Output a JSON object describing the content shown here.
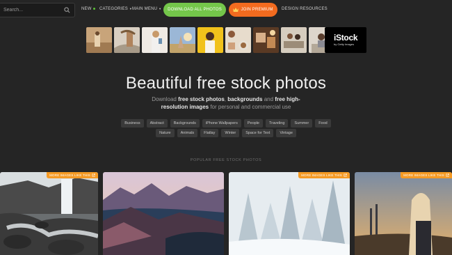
{
  "nav": {
    "search_placeholder": "Search...",
    "new_label": "NEW",
    "categories_label": "CATEGORIES",
    "main_menu_label": "MAIN MENU",
    "download_all_label": "DOWNLOAD ALL PHOTOS",
    "premium_label": "JOIN PREMIUM",
    "design_resources_label": "DESIGN RESOURCES"
  },
  "colors": {
    "accent_green": "#74c64a",
    "accent_orange": "#f26b1f",
    "badge_orange": "#f59a24",
    "background": "#252525"
  },
  "istock": {
    "logo": "iStock",
    "sub": "by Getty Images"
  },
  "hero": {
    "title": "Beautiful free stock photos",
    "sub_prefix": "Download ",
    "sub_b1": "free stock photos",
    "sub_mid1": ", ",
    "sub_b2": "backgrounds",
    "sub_mid2": " and ",
    "sub_b3": "free high-resolution images",
    "sub_suffix": " for personal and commercial use"
  },
  "tags_row1": [
    "Business",
    "Abstract",
    "Backgrounds",
    "iPhone Wallpapers",
    "People",
    "Traveling",
    "Summer",
    "Food"
  ],
  "tags_row2": [
    "Nature",
    "Animals",
    "Flatlay",
    "Winter",
    "Space for Text",
    "Vintage"
  ],
  "section_title": "POPULAR FREE STOCK PHOTOS",
  "badge_label": "MORE IMAGES LIKE THIS",
  "icons": [
    "search-icon",
    "crown-icon",
    "external-link-icon"
  ]
}
